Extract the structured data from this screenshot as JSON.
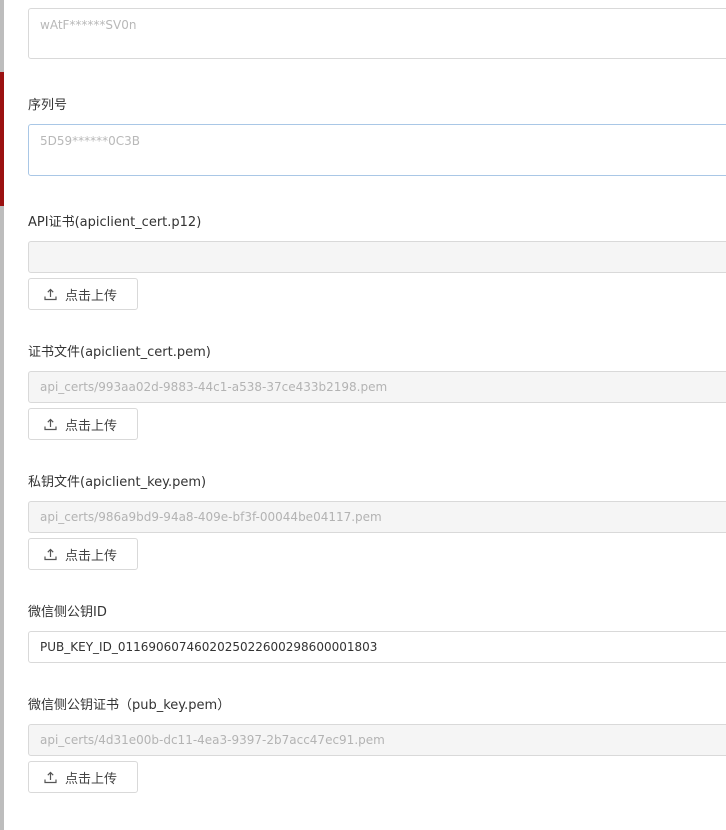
{
  "form": {
    "top_field": {
      "placeholder": "wAtF******SV0n"
    },
    "serial_no": {
      "label": "序列号",
      "placeholder": "5D59******0C3B"
    },
    "api_cert": {
      "label": "API证书(apiclient_cert.p12)",
      "value": "",
      "upload_label": "点击上传"
    },
    "cert_pem": {
      "label": "证书文件(apiclient_cert.pem)",
      "value": "api_certs/993aa02d-9883-44c1-a538-37ce433b2198.pem",
      "upload_label": "点击上传"
    },
    "key_pem": {
      "label": "私钥文件(apiclient_key.pem)",
      "value": "api_certs/986a9bd9-94a8-409e-bf3f-00044be04117.pem",
      "upload_label": "点击上传"
    },
    "pub_key_id": {
      "label": "微信侧公钥ID",
      "value": "PUB_KEY_ID_0116906074602025022600298600001803"
    },
    "pub_key_pem": {
      "label": "微信侧公钥证书（pub_key.pem）",
      "value": "api_certs/4d31e00b-dc11-4ea3-9397-2b7acc47ec91.pem",
      "upload_label": "点击上传"
    }
  },
  "icons": {
    "upload": "upload-icon"
  },
  "colors": {
    "accent_edge": "#9b1111",
    "border": "#d9d9d9",
    "disabled_bg": "#f5f5f5"
  }
}
